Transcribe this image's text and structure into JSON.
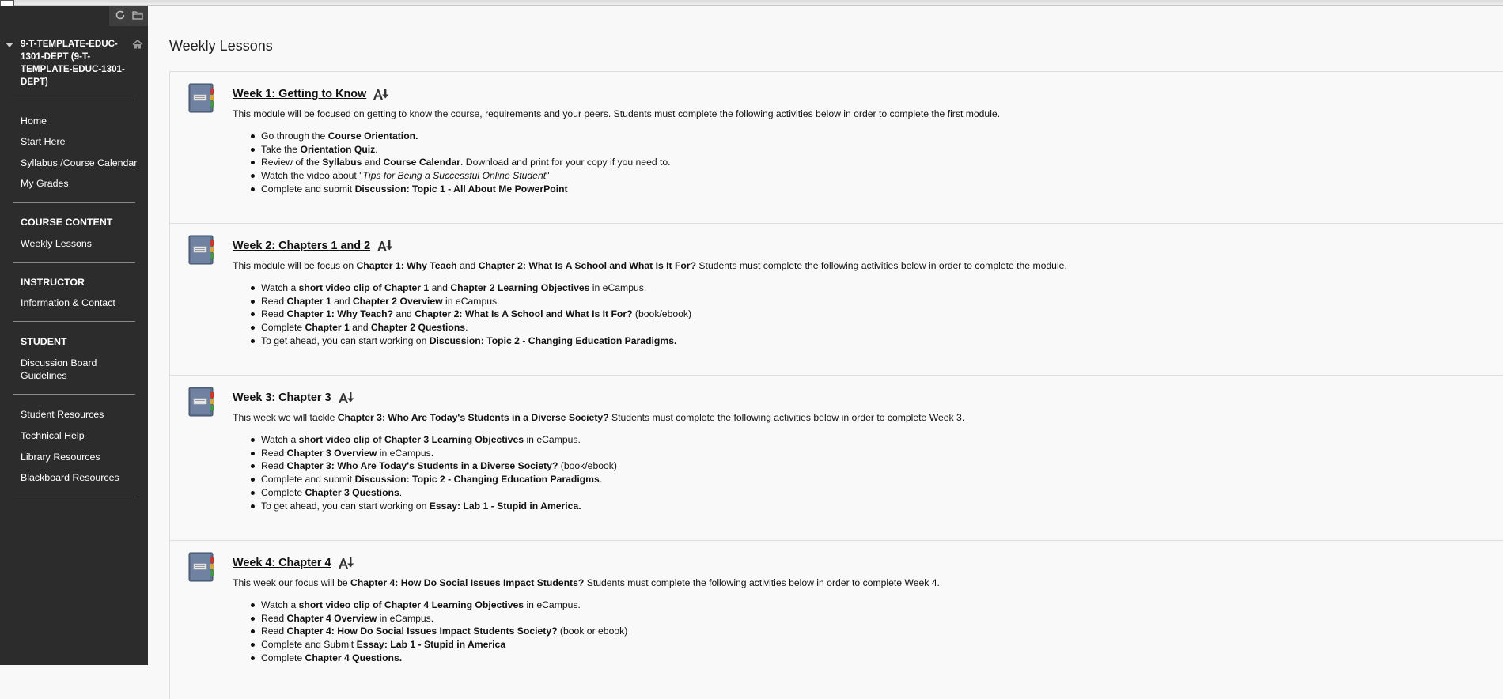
{
  "sidebar": {
    "course_title": "9-T-TEMPLATE-EDUC-1301-DEPT (9-T-TEMPLATE-EDUC-1301-DEPT)",
    "links_top": [
      "Home",
      "Start Here",
      "Syllabus /Course Calendar",
      "My Grades"
    ],
    "sections": [
      {
        "heading": "COURSE CONTENT",
        "links": [
          "Weekly Lessons"
        ]
      },
      {
        "heading": "INSTRUCTOR",
        "links": [
          "Information & Contact"
        ]
      },
      {
        "heading": "STUDENT",
        "links": [
          "Discussion Board Guidelines"
        ]
      }
    ],
    "links_bottom": [
      "Student Resources",
      "Technical Help",
      "Library Resources",
      "Blackboard Resources"
    ]
  },
  "main": {
    "page_title": "Weekly Lessons",
    "lessons": [
      {
        "title": "Week 1: Getting to Know",
        "desc": [
          [
            "This module will be focused on getting to know the course, requirements and your peers. Students must complete the following activities below in order to complete the first module.",
            ""
          ]
        ],
        "items": [
          [
            [
              "Go through the ",
              ""
            ],
            [
              "Course Orientation.",
              "b"
            ]
          ],
          [
            [
              "Take the ",
              ""
            ],
            [
              "Orientation Quiz",
              "b"
            ],
            [
              ".",
              ""
            ]
          ],
          [
            [
              "Review of the ",
              ""
            ],
            [
              "Syllabus",
              "b"
            ],
            [
              " and ",
              ""
            ],
            [
              "Course Calendar",
              "b"
            ],
            [
              ". Download and print for your copy if you need to.",
              ""
            ]
          ],
          [
            [
              "Watch the video about \"",
              ""
            ],
            [
              "Tips for Being a Successful Online Student",
              "i"
            ],
            [
              "\"",
              ""
            ]
          ],
          [
            [
              "Complete and submit ",
              ""
            ],
            [
              "Discussion: Topic 1 - All About Me PowerPoint",
              "b"
            ]
          ]
        ]
      },
      {
        "title": "Week 2: Chapters 1 and 2",
        "desc": [
          [
            "This module will be focus on  ",
            ""
          ],
          [
            "Chapter 1: Why Teach",
            "b"
          ],
          [
            " and ",
            ""
          ],
          [
            "Chapter 2: What Is A School and What Is It For?",
            "b"
          ],
          [
            " Students must complete the following activities below in order to complete the module.",
            ""
          ]
        ],
        "items": [
          [
            [
              "Watch a ",
              ""
            ],
            [
              "short video clip of Chapter 1",
              "b"
            ],
            [
              " and ",
              ""
            ],
            [
              "Chapter 2 Learning Objectives",
              "b"
            ],
            [
              " in eCampus.",
              ""
            ]
          ],
          [
            [
              "Read ",
              ""
            ],
            [
              "Chapter 1",
              "b"
            ],
            [
              " and ",
              ""
            ],
            [
              "Chapter 2 Overview",
              "b"
            ],
            [
              " in eCampus.",
              ""
            ]
          ],
          [
            [
              "Read ",
              ""
            ],
            [
              "Chapter 1: Why Teach?",
              "b"
            ],
            [
              " and ",
              ""
            ],
            [
              "Chapter 2: What Is A School and What Is It For?",
              "b"
            ],
            [
              " (book/ebook)",
              ""
            ]
          ],
          [
            [
              "Complete ",
              ""
            ],
            [
              "Chapter 1",
              "b"
            ],
            [
              " and ",
              ""
            ],
            [
              "Chapter 2 Questions",
              "b"
            ],
            [
              ".",
              ""
            ]
          ],
          [
            [
              "To get ahead, you can start working on ",
              ""
            ],
            [
              "Discussion: Topic 2 - Changing Education Paradigms.",
              "b"
            ]
          ]
        ]
      },
      {
        "title": "Week 3: Chapter 3",
        "desc": [
          [
            "This week we will tackle ",
            ""
          ],
          [
            "Chapter 3: Who Are Today's Students in a Diverse Society?",
            "b"
          ],
          [
            " Students must complete the following activities below in order to complete Week 3.",
            ""
          ]
        ],
        "items": [
          [
            [
              "Watch a ",
              ""
            ],
            [
              "short video clip of Chapter 3 Learning Objectives",
              "b"
            ],
            [
              " in eCampus.",
              ""
            ]
          ],
          [
            [
              "Read ",
              ""
            ],
            [
              "Chapter 3 Overview",
              "b"
            ],
            [
              " in eCampus.",
              ""
            ]
          ],
          [
            [
              "Read ",
              ""
            ],
            [
              "Chapter 3: Who Are Today's Students in a Diverse Society?",
              "b"
            ],
            [
              " (book/ebook)",
              ""
            ]
          ],
          [
            [
              "Complete and submit ",
              ""
            ],
            [
              "Discussion: Topic 2 - Changing Education Paradigms",
              "b"
            ],
            [
              ".",
              ""
            ]
          ],
          [
            [
              "Complete ",
              ""
            ],
            [
              "Chapter 3 Questions",
              "b"
            ],
            [
              ".",
              ""
            ]
          ],
          [
            [
              "To get ahead, you can start working on ",
              ""
            ],
            [
              "Essay: Lab 1 - Stupid in America.",
              "b"
            ]
          ]
        ]
      },
      {
        "title": "Week 4: Chapter 4",
        "desc": [
          [
            "This week our focus will be ",
            ""
          ],
          [
            "Chapter 4: How Do Social Issues Impact Students?",
            "b"
          ],
          [
            " Students must complete the following activities below in order to complete Week 4.",
            ""
          ]
        ],
        "items": [
          [
            [
              "Watch a ",
              ""
            ],
            [
              "short video clip of Chapter 4 Learning Objectives",
              "b"
            ],
            [
              " in eCampus.",
              ""
            ]
          ],
          [
            [
              "Read ",
              ""
            ],
            [
              "Chapter 4 Overview",
              "b"
            ],
            [
              " in eCampus.",
              ""
            ]
          ],
          [
            [
              "Read ",
              ""
            ],
            [
              "Chapter 4: How Do Social Issues Impact Students Society?",
              "b"
            ],
            [
              " (book or ebook)",
              ""
            ]
          ],
          [
            [
              "Complete and Submit ",
              ""
            ],
            [
              "Essay: Lab 1 - Stupid in America",
              "b"
            ]
          ],
          [
            [
              "Complete ",
              ""
            ],
            [
              "Chapter 4 Questions.",
              "b"
            ]
          ]
        ]
      }
    ]
  },
  "icons": {
    "refresh": "refresh-icon",
    "folder": "folder-icon",
    "home": "home-icon",
    "lesson": "notebook-icon",
    "sort": "text-sort-icon"
  },
  "colors": {
    "sidebar_bg": "#2c2c2c",
    "main_bg": "#f8f8f8",
    "notebook": "#5b6f8e",
    "tab_red": "#d0352b",
    "tab_yellow": "#e1a12a",
    "tab_green": "#3f9a44"
  }
}
